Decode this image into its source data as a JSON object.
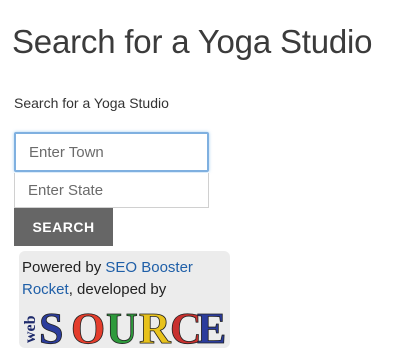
{
  "page": {
    "title": "Search for a Yoga Studio"
  },
  "form": {
    "label": "Search for a Yoga Studio",
    "town_placeholder": "Enter Town",
    "state_placeholder": "Enter State",
    "search_button": "SEARCH"
  },
  "powered": {
    "prefix": "Powered by ",
    "link1": "SEO Booster Rocket",
    "middle": ", developed by",
    "logo_small": "web",
    "logo_letters": [
      "S",
      "O",
      "U",
      "R",
      "C",
      "E"
    ],
    "logo_colors": [
      "#2b3c9c",
      "#e43d2c",
      "#2e9a3c",
      "#e8c21c",
      "#c8302e",
      "#2b3c9c"
    ]
  },
  "colors": {
    "link": "#1f5fa8",
    "button_bg": "#666666",
    "focus_border": "#7fb0e0"
  }
}
